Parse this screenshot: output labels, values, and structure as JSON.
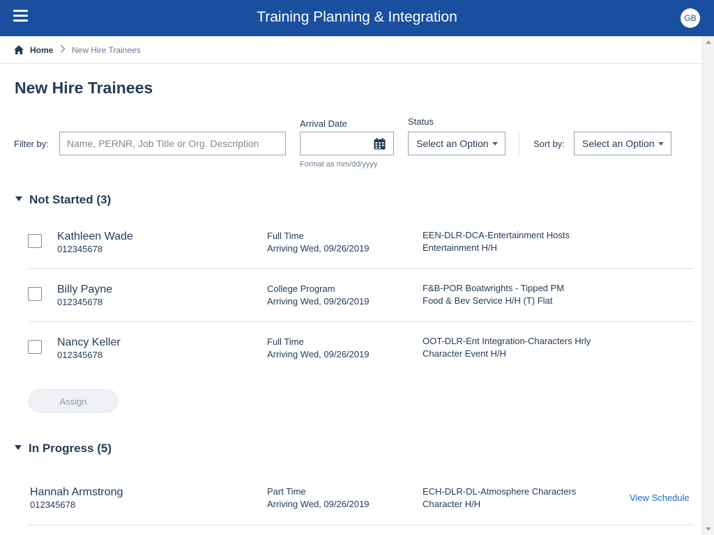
{
  "header": {
    "title": "Training Planning & Integration",
    "avatar_initials": "GB"
  },
  "breadcrumb": {
    "home": "Home",
    "current": "New Hire Trainees"
  },
  "page": {
    "title": "New Hire Trainees"
  },
  "filters": {
    "filter_label": "Filter by:",
    "search_placeholder": "Name, PERNR, Job Title or Org. Description",
    "arrival_label": "Arrival Date",
    "arrival_value": "",
    "arrival_hint": "Format as mm/dd/yyyy",
    "status_label": "Status",
    "status_value": "Select an Option",
    "sort_label": "Sort by:",
    "sort_value": "Select an Option"
  },
  "not_started": {
    "heading": "Not Started (3)",
    "rows": [
      {
        "name": "Kathleen Wade",
        "pernr": "012345678",
        "type": "Full Time",
        "arrival": "Arriving Wed, 09/26/2019",
        "org": "EEN-DLR-DCA-Entertainment Hosts",
        "job": "Entertainment H/H"
      },
      {
        "name": "Billy Payne",
        "pernr": "012345678",
        "type": "College Program",
        "arrival": "Arriving Wed, 09/26/2019",
        "org": "F&B-POR Boatwrights - Tipped PM",
        "job": "Food & Bev Service H/H (T) Flat"
      },
      {
        "name": "Nancy Keller",
        "pernr": "012345678",
        "type": "Full Time",
        "arrival": "Arriving Wed, 09/26/2019",
        "org": "OOT-DLR-Ent Integration-Characters Hrly",
        "job": "Character Event H/H"
      }
    ],
    "assign_label": "Assign"
  },
  "in_progress": {
    "heading": "In Progress (5)",
    "rows": [
      {
        "name": "Hannah Armstrong",
        "pernr": "012345678",
        "type": "Part Time",
        "arrival": "Arriving Wed, 09/26/2019",
        "org": "ECH-DLR-DL-Atmosphere Characters",
        "job": "Character H/H",
        "action": "View Schedule"
      }
    ]
  },
  "colors": {
    "header_bg": "#1a4f9f",
    "text": "#253b56",
    "link": "#1a6cc8"
  },
  "icons": [
    "menu-icon",
    "home-icon",
    "chevron-right-icon",
    "calendar-icon",
    "caret-down-icon",
    "triangle-down-icon"
  ]
}
